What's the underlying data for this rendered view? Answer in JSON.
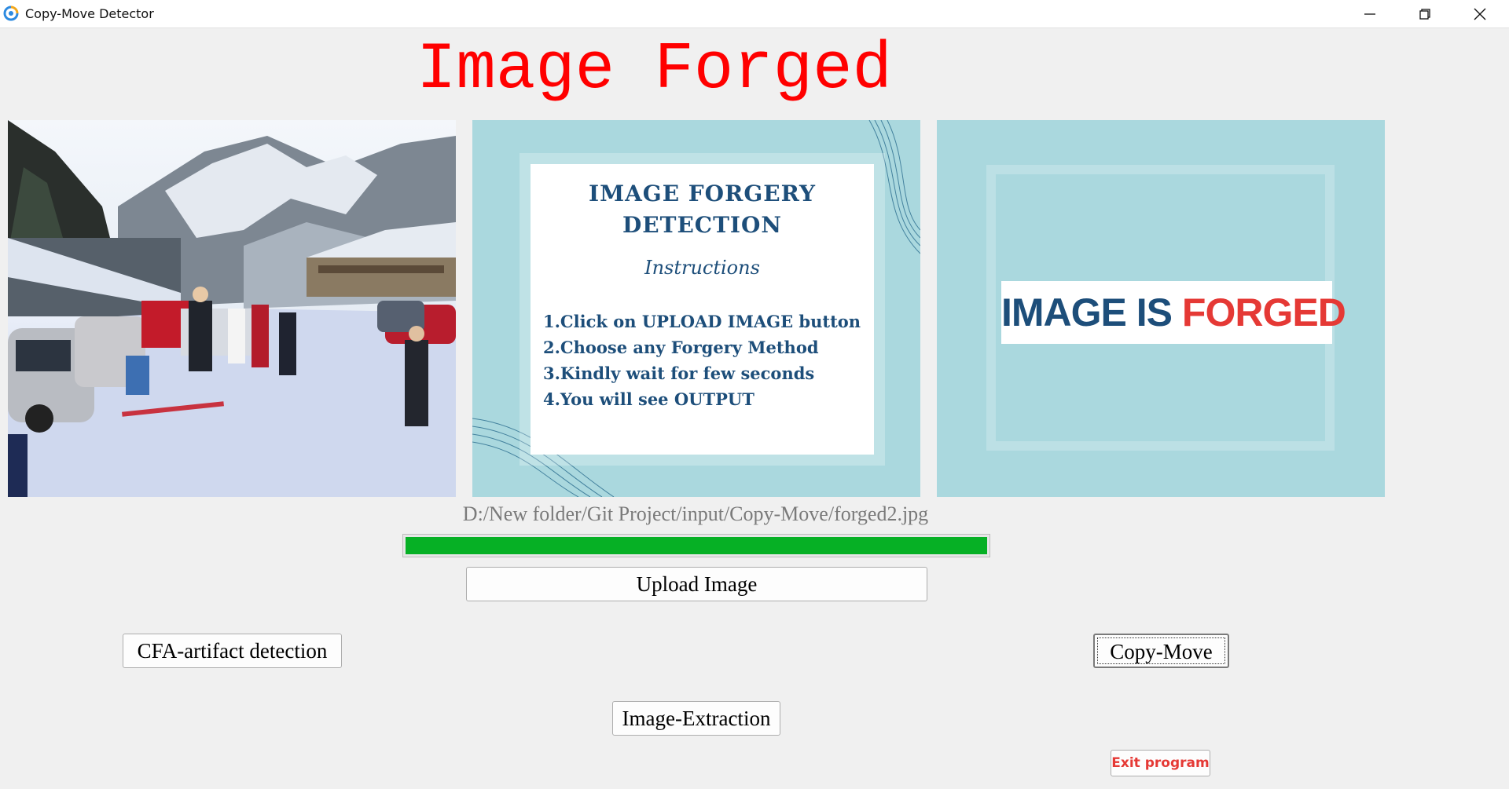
{
  "window": {
    "title": "Copy-Move Detector",
    "app_icon": "refresh-circle-icon",
    "controls": [
      "minimize-icon",
      "restore-icon",
      "close-icon"
    ]
  },
  "headline": {
    "text": "Image Forged",
    "color": "#ff0000"
  },
  "panels": {
    "input_image": {
      "description": "snowy mountain parking lot with skiers"
    },
    "instructions": {
      "title": "IMAGE FORGERY DETECTION",
      "subtitle": "Instructions",
      "steps": [
        "1.Click on UPLOAD IMAGE button",
        "2.Choose any Forgery Method",
        "3.Kindly wait for few seconds",
        "4.You will see OUTPUT"
      ]
    },
    "result": {
      "text_a": "IMAGE IS ",
      "text_b": "FORGED",
      "color_a": "#1d4e7a",
      "color_b": "#e53935"
    }
  },
  "file_path": "D:/New folder/Git Project/input/Copy-Move/forged2.jpg",
  "progress": {
    "value_percent": 100,
    "color": "#06b025"
  },
  "buttons": {
    "upload": "Upload Image",
    "cfa": "CFA-artifact detection",
    "copy_move": "Copy-Move",
    "extraction": "Image-Extraction",
    "exit": "Exit program"
  }
}
